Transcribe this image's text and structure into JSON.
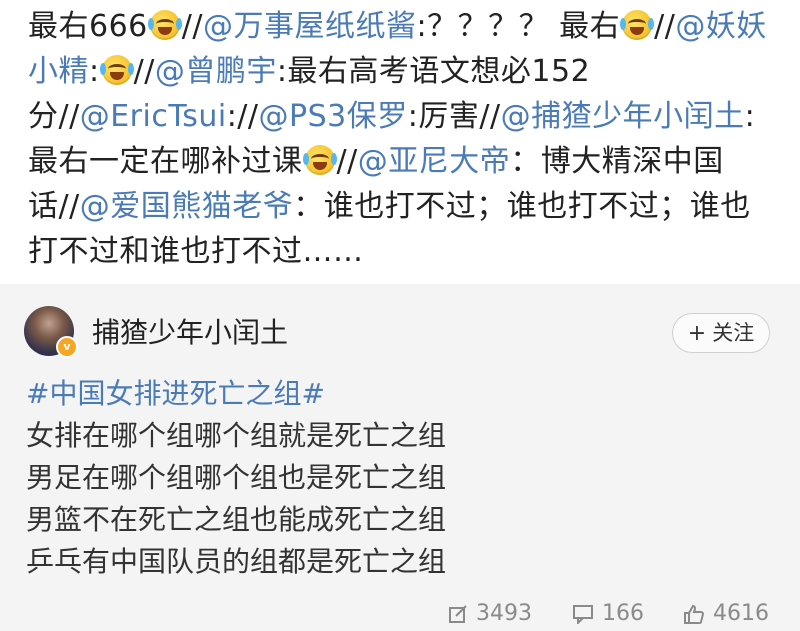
{
  "repost": {
    "segments": [
      {
        "t": "最右666",
        "c": "plain"
      },
      {
        "t": "emoji",
        "c": "emoji"
      },
      {
        "t": "//",
        "c": "plain"
      },
      {
        "t": "@万事屋纸纸酱",
        "c": "at"
      },
      {
        "t": ":？？？？ 最右",
        "c": "plain"
      },
      {
        "t": "emoji",
        "c": "emoji"
      },
      {
        "t": "//",
        "c": "plain"
      },
      {
        "t": "@妖妖小精",
        "c": "at"
      },
      {
        "t": ":",
        "c": "plain"
      },
      {
        "t": "emoji",
        "c": "emoji"
      },
      {
        "t": "//",
        "c": "plain"
      },
      {
        "t": "@曾鹏宇",
        "c": "at"
      },
      {
        "t": ":最右高考语文想必152分//",
        "c": "plain"
      },
      {
        "t": "@EricTsui",
        "c": "at"
      },
      {
        "t": "://",
        "c": "plain"
      },
      {
        "t": "@PS3保罗",
        "c": "at"
      },
      {
        "t": ":厉害//",
        "c": "plain"
      },
      {
        "t": "@捕猹少年小闰土",
        "c": "at"
      },
      {
        "t": ":最右一定在哪补过课",
        "c": "plain"
      },
      {
        "t": "emoji",
        "c": "emoji"
      },
      {
        "t": "//",
        "c": "plain"
      },
      {
        "t": "@亚尼大帝",
        "c": "at"
      },
      {
        "t": "：博大精深中国话//",
        "c": "plain"
      },
      {
        "t": "@爱国熊猫老爷",
        "c": "at"
      },
      {
        "t": "：谁也打不过；谁也打不过；谁也打不过和谁也打不过……",
        "c": "plain"
      }
    ]
  },
  "post": {
    "username": "捕猹少年小闰土",
    "follow_label": "关注",
    "topic": "#中国女排进死亡之组#",
    "lines": [
      "女排在哪个组哪个组就是死亡之组",
      "男足在哪个组哪个组也是死亡之组",
      "男篮不在死亡之组也能成死亡之组",
      "乒乓有中国队员的组都是死亡之组"
    ],
    "reposts": "3493",
    "comments": "166",
    "likes": "4616"
  },
  "colors": {
    "link": "#4a7bb7",
    "bg": "#f4f4f4"
  }
}
